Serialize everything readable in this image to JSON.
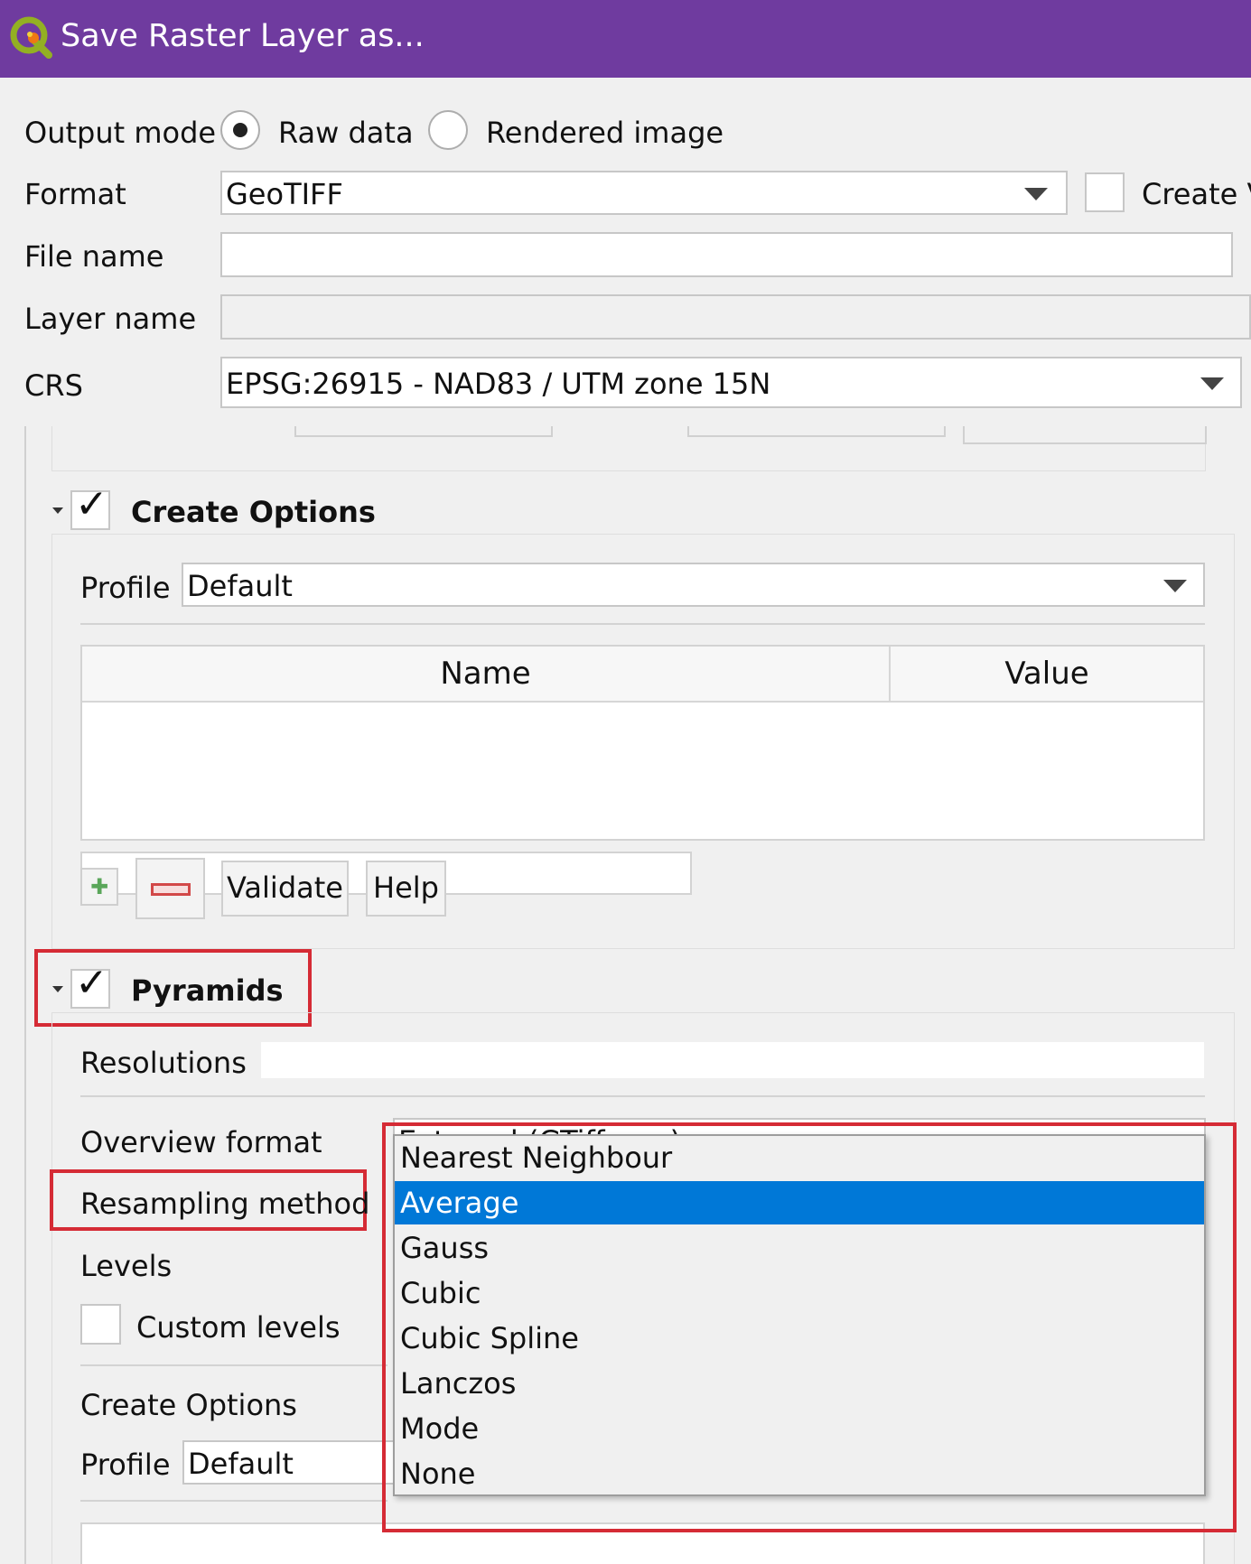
{
  "window": {
    "title": "Save Raster Layer as..."
  },
  "output_mode": {
    "label": "Output mode",
    "options": [
      "Raw data",
      "Rendered image"
    ],
    "selected": "Raw data"
  },
  "format": {
    "label": "Format",
    "value": "GeoTIFF",
    "create_vrt_label": "Create V"
  },
  "file_name": {
    "label": "File name",
    "value": ""
  },
  "layer_name": {
    "label": "Layer name",
    "value": ""
  },
  "crs": {
    "label": "CRS",
    "value": "EPSG:26915 - NAD83 / UTM zone 15N"
  },
  "create_options": {
    "title": "Create Options",
    "checked": true,
    "profile_label": "Profile",
    "profile_value": "Default",
    "table": {
      "columns": [
        "Name",
        "Value"
      ],
      "rows": []
    },
    "buttons": {
      "validate": "Validate",
      "help": "Help"
    }
  },
  "pyramids": {
    "title": "Pyramids",
    "checked": true,
    "resolutions_label": "Resolutions",
    "resolutions_value": "",
    "overview_format_label": "Overview format",
    "overview_format_value": "External (GTiff .ovr)",
    "resampling_label": "Resampling method",
    "levels_label": "Levels",
    "custom_levels_label": "Custom levels",
    "create_options_label": "Create Options",
    "profile_label": "Profile",
    "profile_value": "Default"
  },
  "resampling_dropdown": {
    "options": [
      "Nearest Neighbour",
      "Average",
      "Gauss",
      "Cubic",
      "Cubic Spline",
      "Lanczos",
      "Mode",
      "None"
    ],
    "selected": "Average"
  },
  "colors": {
    "titlebar": "#6f3b9f",
    "selection": "#0078d7",
    "highlight_box": "#d52b35"
  }
}
